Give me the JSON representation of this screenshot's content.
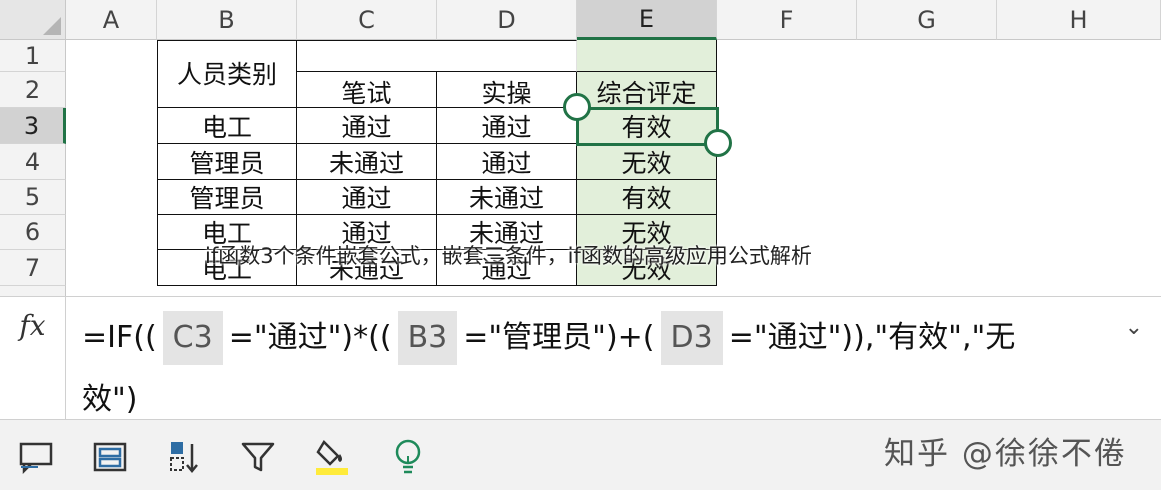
{
  "columns": [
    "A",
    "B",
    "C",
    "D",
    "E",
    "F",
    "G",
    "H"
  ],
  "rows": [
    "1",
    "2",
    "3",
    "4",
    "5",
    "6",
    "7"
  ],
  "selected": {
    "column": "E",
    "row": "3"
  },
  "table": {
    "header_group": "人员类别",
    "headers": [
      "笔试",
      "实操",
      "综合评定"
    ],
    "rows": [
      [
        "电工",
        "通过",
        "通过",
        "有效"
      ],
      [
        "管理员",
        "未通过",
        "通过",
        "无效"
      ],
      [
        "管理员",
        "通过",
        "未通过",
        "有效"
      ],
      [
        "电工",
        "通过",
        "未通过",
        "无效"
      ],
      [
        "电工",
        "未通过",
        "通过",
        "无效"
      ]
    ]
  },
  "watermark": "if函数3个条件嵌套公式，嵌套三条件，if函数的高级应用公式解析",
  "formula_bar": {
    "fx_label": "fx",
    "p1": "=IF((",
    "ref1": "C3",
    "p2": "=\"通过\")*((",
    "ref2": "B3",
    "p3": "=\"管理员\")+(",
    "ref3": "D3",
    "p4": "=\"通过\")),\"有效\",\"无",
    "p5": "效\")"
  },
  "brand": "知乎 @徐徐不倦",
  "colors": {
    "accent": "#217346",
    "fill": "#e2efda",
    "ref_bg": "#e4e4e4",
    "toolbar_bg": "#f2f2f2",
    "highlight": "#ffeb3b"
  },
  "toolbar_icons": [
    "comment-icon",
    "format-cells-icon",
    "sort-icon",
    "filter-icon",
    "fill-color-icon",
    "idea-icon"
  ]
}
